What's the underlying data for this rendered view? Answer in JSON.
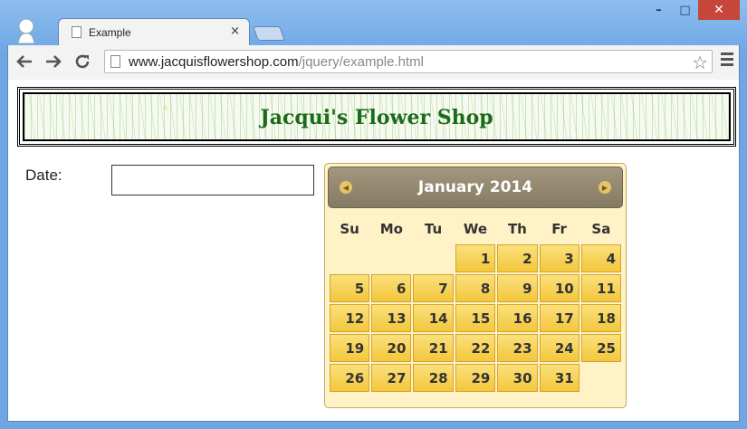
{
  "browser": {
    "tab_title": "Example",
    "tab_close": "×",
    "url_host": "www.jacquisflowershop.com",
    "url_path": "/jquery/example.html",
    "win_minimize": "–",
    "win_maximize": "□",
    "win_close": "✕"
  },
  "page": {
    "shop_title": "Jacqui's Flower Shop",
    "date_label": "Date:",
    "date_value": ""
  },
  "datepicker": {
    "month_title": "January 2014",
    "weekdays": [
      "Su",
      "Mo",
      "Tu",
      "We",
      "Th",
      "Fr",
      "Sa"
    ],
    "weeks": [
      [
        "",
        "",
        "",
        "1",
        "2",
        "3",
        "4"
      ],
      [
        "5",
        "6",
        "7",
        "8",
        "9",
        "10",
        "11"
      ],
      [
        "12",
        "13",
        "14",
        "15",
        "16",
        "17",
        "18"
      ],
      [
        "19",
        "20",
        "21",
        "22",
        "23",
        "24",
        "25"
      ],
      [
        "26",
        "27",
        "28",
        "29",
        "30",
        "31",
        ""
      ]
    ]
  },
  "colors": {
    "title_green": "#1c6b1a",
    "day_cell": "#f3c73c",
    "header_bg": "#857a63"
  }
}
